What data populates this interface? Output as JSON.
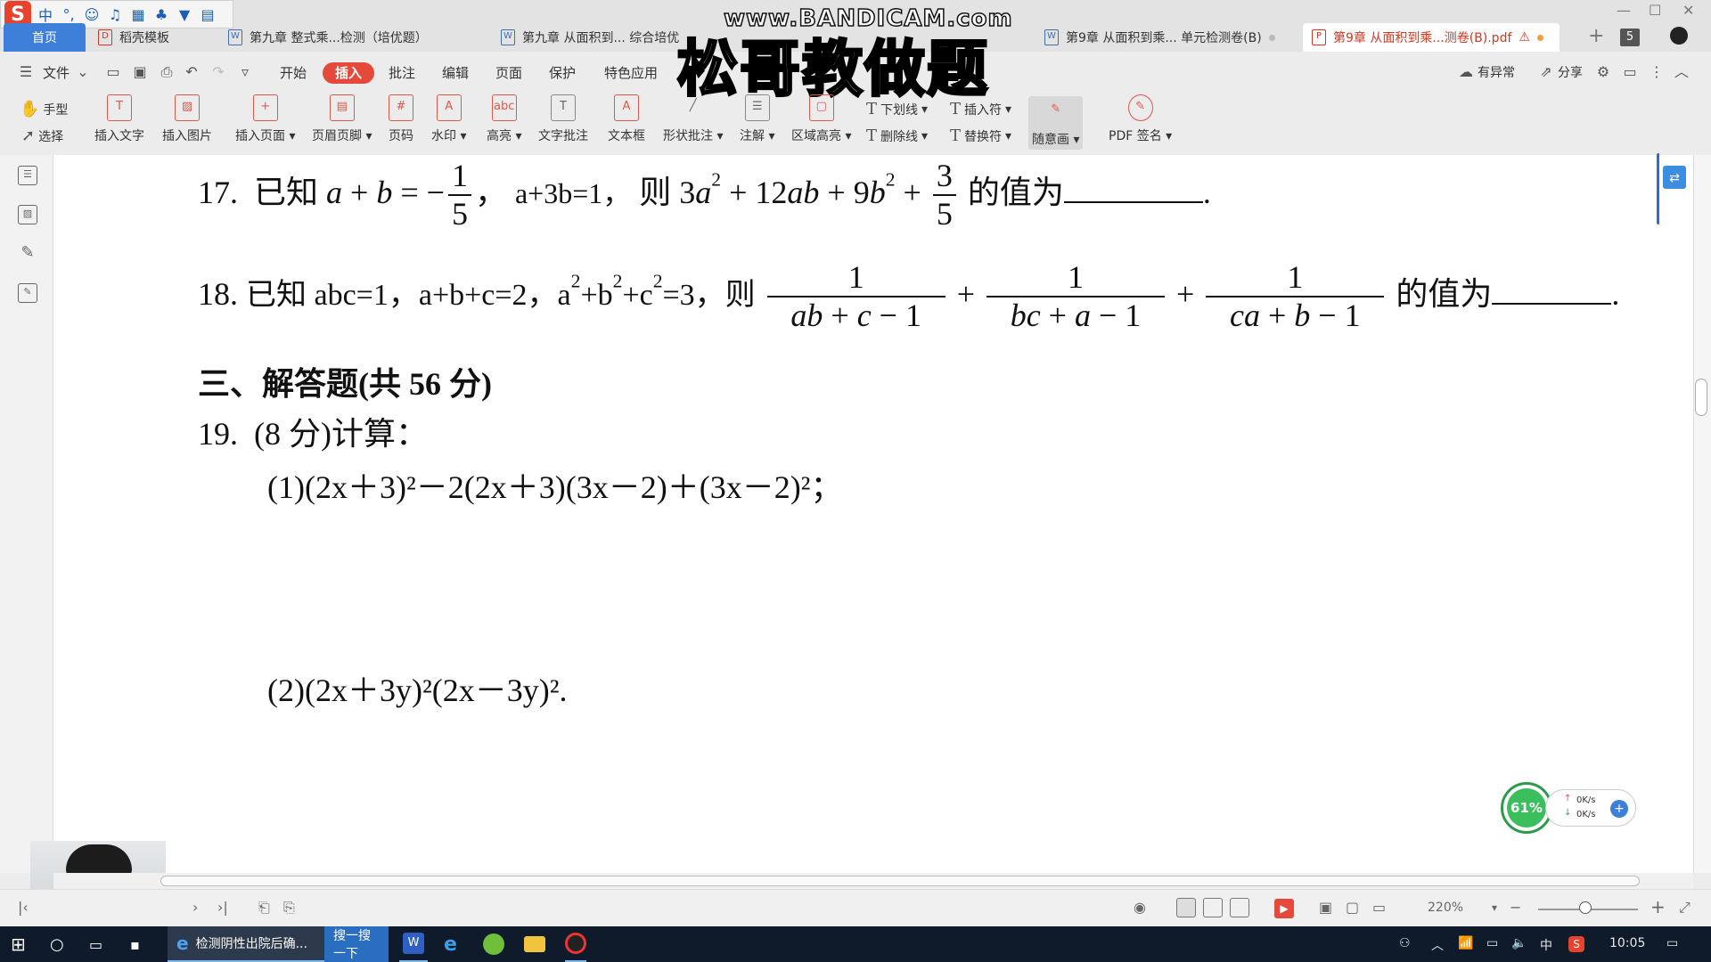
{
  "ime": {
    "logo": "S",
    "items": [
      "中",
      "°,",
      "☺",
      "♫",
      "▦",
      "♣",
      "▼",
      "▤"
    ]
  },
  "tabs": [
    {
      "label": "首页"
    },
    {
      "label": "稻壳模板"
    },
    {
      "label": "第九章 整式乘...检测（培优题）"
    },
    {
      "label": "第九章 从面积到... 综合培优"
    },
    {
      "label": "第9章 从面积到乘... 单元检测卷(B)"
    },
    {
      "label": "第9章 从面积到乘...测卷(B).pdf"
    }
  ],
  "tab_count": "5",
  "watermark": {
    "url": "www.BANDICAM.com",
    "main": "松哥教做题"
  },
  "menu": {
    "file": "文件",
    "items": [
      "开始",
      "插入",
      "批注",
      "编辑",
      "页面",
      "保护",
      "特色应用"
    ],
    "selected": "插入",
    "right": {
      "issue": "有异常",
      "share": "分享"
    }
  },
  "ribbon": {
    "hand": "手型",
    "select": "选择",
    "tools": [
      "插入文字",
      "插入图片",
      "插入页面",
      "页眉页脚",
      "页码",
      "水印",
      "高亮",
      "文字批注",
      "文本框",
      "形状批注",
      "注解",
      "区域高亮"
    ],
    "underline": "下划线",
    "strike": "删除线",
    "insert_sym": "插入符",
    "replace_sym": "替换符",
    "freehand": "随意画",
    "sign": "PDF 签名"
  },
  "document": {
    "q17": {
      "num": "17.",
      "text1": "已知",
      "cond": "a+3b=1，",
      "then": "则",
      "tail": "的值为",
      "end": "."
    },
    "q18": {
      "num": "18.",
      "text1": "已知 abc=1，a+b+c=2，a",
      "text2": "+b",
      "text3": "+c",
      "text4": "=3，则",
      "tail": "的值为",
      "end": "."
    },
    "section": "三、解答题(共 56 分)",
    "q19": {
      "num": "19.",
      "head": "(8 分)计算：",
      "p1": "(1)(2x＋3)²－2(2x＋3)(3x－2)＋(3x－2)²；",
      "p2": "(2)(2x＋3y)²(2x－3y)²."
    }
  },
  "speed": {
    "percent": "61%",
    "up": "0K/s",
    "down": "0K/s"
  },
  "statusbar": {
    "zoom": "220%"
  },
  "taskbar": {
    "ie_task": "检测阴性出院后确...",
    "search": "搜一搜一下",
    "ime": "中",
    "time": "10:05"
  }
}
